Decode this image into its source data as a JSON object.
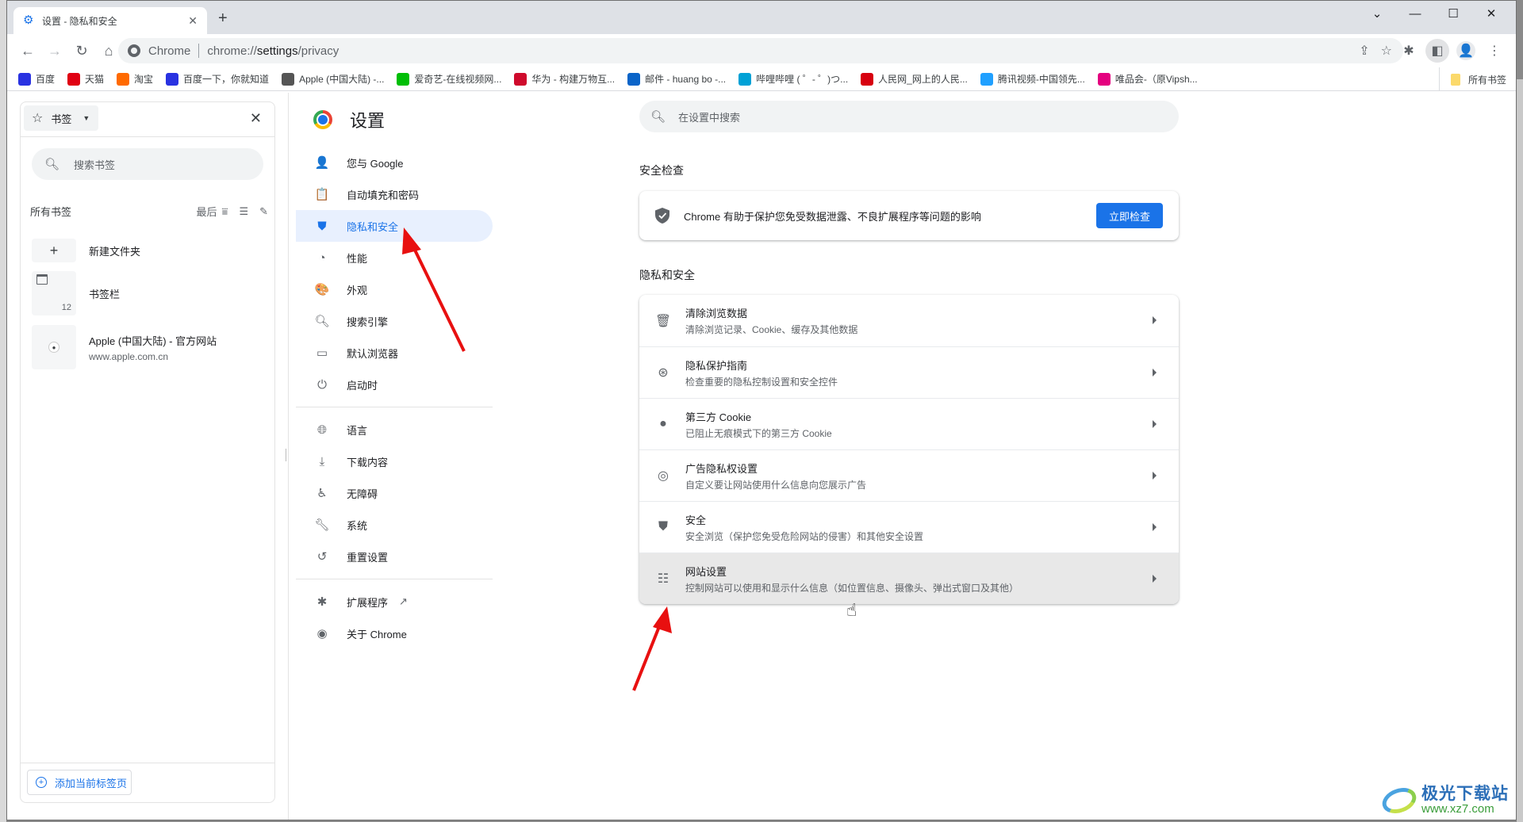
{
  "window": {
    "tab_title": "设置 - 隐私和安全",
    "tab_icon": "gear-icon",
    "controls": [
      "tab-search",
      "minimize",
      "maximize",
      "close"
    ]
  },
  "toolbar": {
    "chip": "Chrome",
    "url_prefix": "chrome://",
    "url_host": "settings",
    "url_path": "/privacy"
  },
  "bookmarks_bar": {
    "items": [
      {
        "label": "百度",
        "icon": "baidu-icon",
        "color": "#2932e1"
      },
      {
        "label": "天猫",
        "icon": "tmall-icon",
        "color": "#e00012"
      },
      {
        "label": "淘宝",
        "icon": "taobao-icon",
        "color": "#ff6a00"
      },
      {
        "label": "百度一下，你就知道",
        "icon": "baidu-icon",
        "color": "#2932e1"
      },
      {
        "label": "Apple (中国大陆) -...",
        "icon": "apple-icon",
        "color": "#555555"
      },
      {
        "label": "爱奇艺-在线视频网...",
        "icon": "iqiyi-icon",
        "color": "#00be06"
      },
      {
        "label": "华为 - 构建万物互...",
        "icon": "huawei-icon",
        "color": "#cf0a2c"
      },
      {
        "label": "邮件 - huang bo -...",
        "icon": "outlook-icon",
        "color": "#0a64c8"
      },
      {
        "label": "哔哩哔哩 ( ゜- ゜)つ...",
        "icon": "bilibili-icon",
        "color": "#00a1d6"
      },
      {
        "label": "人民网_网上的人民...",
        "icon": "people-icon",
        "color": "#d7000f"
      },
      {
        "label": "腾讯视频-中国领先...",
        "icon": "tencent-video-icon",
        "color": "#20a0ff"
      },
      {
        "label": "唯品会-（原Vipsh...",
        "icon": "vip-icon",
        "color": "#e4007f"
      }
    ],
    "all_bookmarks": "所有书签"
  },
  "bookmark_panel": {
    "selector_label": "书签",
    "search_placeholder": "搜索书签",
    "section_title": "所有书签",
    "sort_label": "最后",
    "items": [
      {
        "title": "新建文件夹",
        "type": "new-folder"
      },
      {
        "title": "书签栏",
        "type": "folder",
        "count": "12"
      },
      {
        "title": "Apple (中国大陆) - 官方网站",
        "url": "www.apple.com.cn",
        "type": "bookmark"
      }
    ],
    "add_current_tab": "添加当前标签页"
  },
  "settings": {
    "title": "设置",
    "search_placeholder": "在设置中搜索",
    "nav": [
      {
        "label": "您与 Google",
        "icon": "person-icon"
      },
      {
        "label": "自动填充和密码",
        "icon": "clipboard-icon"
      },
      {
        "label": "隐私和安全",
        "icon": "shield-icon",
        "active": true
      },
      {
        "label": "性能",
        "icon": "speedometer-icon"
      },
      {
        "label": "外观",
        "icon": "palette-icon"
      },
      {
        "label": "搜索引擎",
        "icon": "search-icon"
      },
      {
        "label": "默认浏览器",
        "icon": "browser-icon"
      },
      {
        "label": "启动时",
        "icon": "power-icon"
      }
    ],
    "nav2": [
      {
        "label": "语言",
        "icon": "globe-icon"
      },
      {
        "label": "下载内容",
        "icon": "download-icon"
      },
      {
        "label": "无障碍",
        "icon": "accessibility-icon"
      },
      {
        "label": "系统",
        "icon": "wrench-icon"
      },
      {
        "label": "重置设置",
        "icon": "history-icon"
      }
    ],
    "nav3": [
      {
        "label": "扩展程序",
        "icon": "puzzle-icon"
      },
      {
        "label": "关于 Chrome",
        "icon": "chrome-icon"
      }
    ],
    "safety_check": {
      "section_title": "安全检查",
      "text": "Chrome 有助于保护您免受数据泄露、不良扩展程序等问题的影响",
      "button": "立即检查"
    },
    "privacy": {
      "section_title": "隐私和安全",
      "rows": [
        {
          "title": "清除浏览数据",
          "subtitle": "清除浏览记录、Cookie、缓存及其他数据",
          "icon": "trash-icon"
        },
        {
          "title": "隐私保护指南",
          "subtitle": "检查重要的隐私控制设置和安全控件",
          "icon": "compass-icon"
        },
        {
          "title": "第三方 Cookie",
          "subtitle": "已阻止无痕模式下的第三方 Cookie",
          "icon": "cookie-icon"
        },
        {
          "title": "广告隐私权设置",
          "subtitle": "自定义要让网站使用什么信息向您展示广告",
          "icon": "ads-click-icon"
        },
        {
          "title": "安全",
          "subtitle": "安全浏览（保护您免受危险网站的侵害）和其他安全设置",
          "icon": "security-shield-icon"
        },
        {
          "title": "网站设置",
          "subtitle": "控制网站可以使用和显示什么信息（如位置信息、摄像头、弹出式窗口及其他）",
          "icon": "tune-icon",
          "hovered": true
        }
      ]
    }
  },
  "watermark": {
    "title": "极光下载站",
    "url": "www.xz7.com"
  },
  "colors": {
    "accent": "#1a73e8",
    "active_nav_bg": "#e8f0fe",
    "annotation_arrow": "#e81010"
  }
}
